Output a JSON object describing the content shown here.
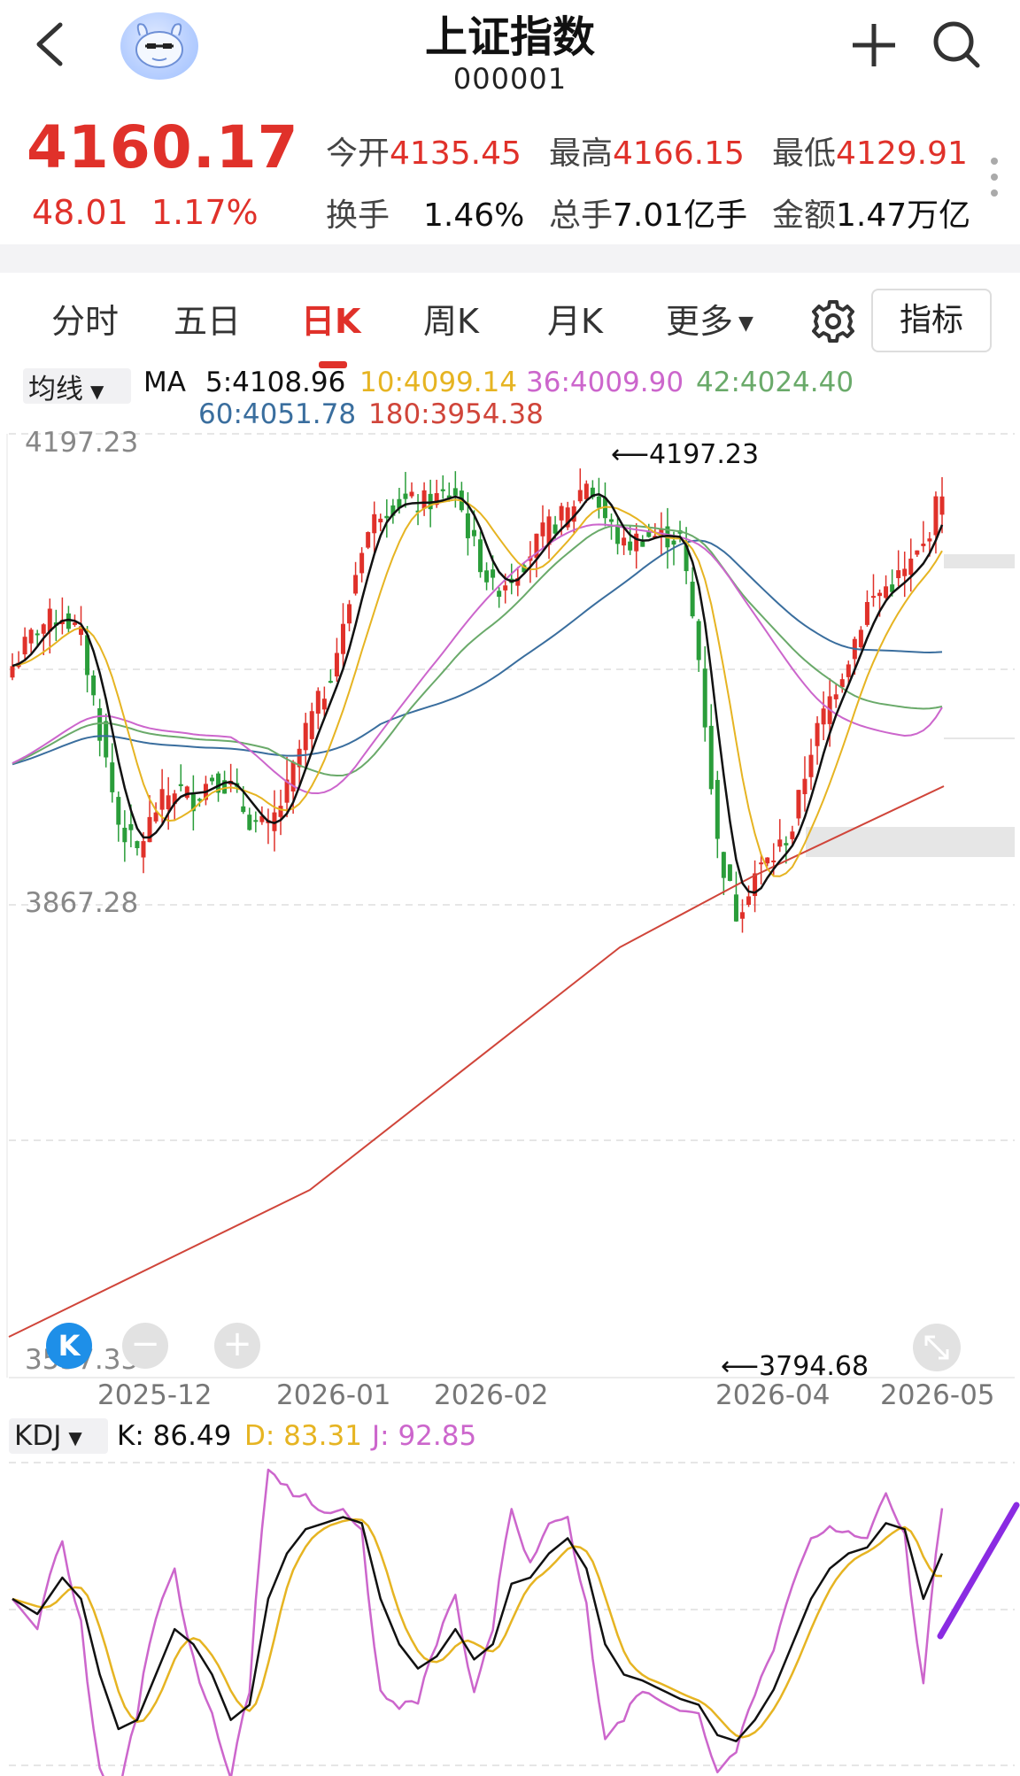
{
  "header": {
    "title": "上证指数",
    "code": "000001",
    "price": "4160.17",
    "change": "48.01",
    "change_pct": "1.17%",
    "open_label": "今开",
    "open_value": "4135.45",
    "high_label": "最高",
    "high_value": "4166.15",
    "low_label": "最低",
    "low_value": "4129.91",
    "turnover_label": "换手",
    "turnover_value": "1.46%",
    "volume_label": "总手",
    "volume_value": "7.01亿手",
    "amount_label": "金额",
    "amount_value": "1.47万亿"
  },
  "tabs": [
    "分时",
    "五日",
    "日K",
    "周K",
    "月K",
    "更多"
  ],
  "active_tab": "日K",
  "indicator_label": "指标",
  "icons": [
    "back-icon",
    "avatar",
    "plus-icon",
    "search-icon",
    "gear-icon",
    "zoom-out-icon",
    "zoom-in-icon",
    "fullscreen-icon",
    "k-logo-icon"
  ],
  "colors": {
    "up": "#e0312a",
    "down": "#2a9d3a",
    "ma5": "#111111",
    "ma10": "#e6b422",
    "ma36": "#cc66cc",
    "ma42": "#6aaa6a",
    "ma60": "#3a6e9e",
    "ma180": "#d0453a",
    "kdj_k": "#111111",
    "kdj_d": "#e6b422",
    "kdj_j": "#cc66cc"
  },
  "ma_legend": {
    "selector": "均线",
    "ma": "MA",
    "ma5": "5:4108.96",
    "ma10": "10:4099.14",
    "ma36": "36:4009.90",
    "ma42": "42:4024.40",
    "ma60": "60:4051.78",
    "ma180": "180:3954.38"
  },
  "kdj_legend": {
    "selector": "KDJ",
    "k": "K: 86.49",
    "d": "D: 83.31",
    "j": "J: 92.85"
  },
  "chart_data": [
    {
      "type": "candlestick",
      "y_labels": [
        "4197.23",
        "3867.28",
        "3537.33"
      ],
      "ylim": [
        3537.33,
        4197.23
      ],
      "x_labels": [
        "2025-12",
        "2026-01",
        "2026-02",
        "2026-04",
        "2026-05"
      ],
      "annotations": {
        "high": "4197.23",
        "low": "3794.68"
      },
      "legend": "top-left"
    },
    {
      "type": "line",
      "series_names": [
        "K",
        "D",
        "J"
      ],
      "latest": {
        "K": 86.49,
        "D": 83.31,
        "J": 92.85
      },
      "legend": "top-left"
    }
  ]
}
